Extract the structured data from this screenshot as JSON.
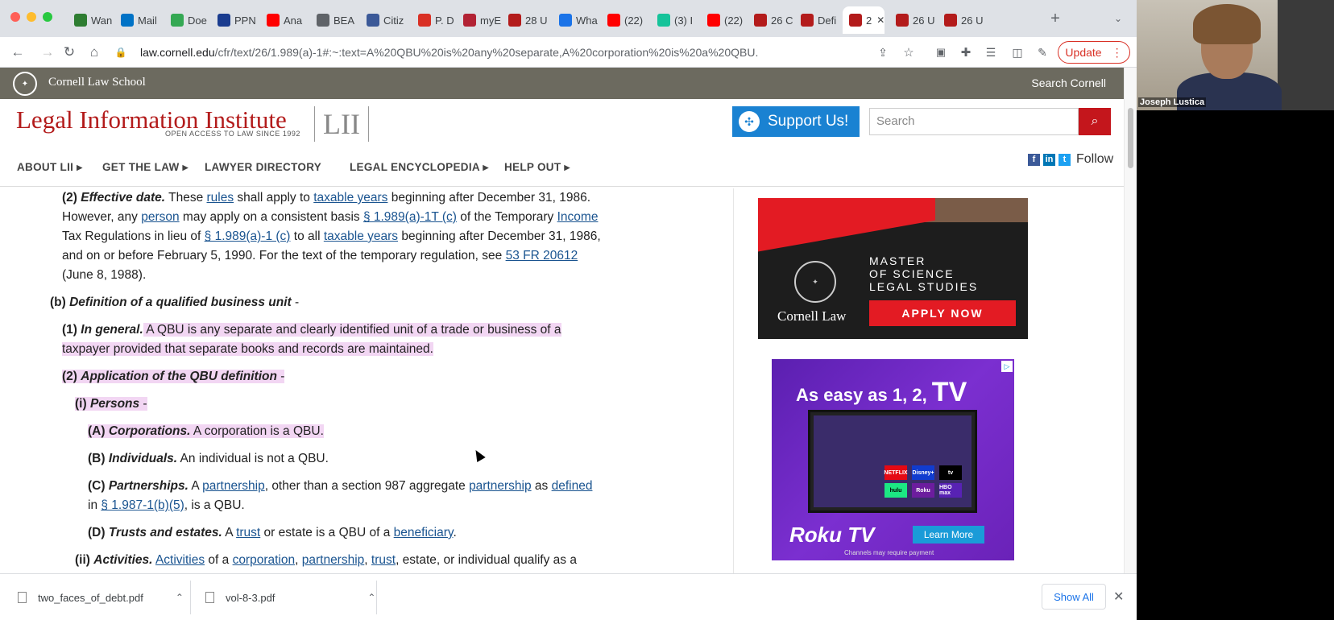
{
  "tabs": [
    {
      "label": "Wan",
      "icon": "green-square-icon",
      "color": "#2e7d32"
    },
    {
      "label": "Mail",
      "icon": "outlook-icon",
      "color": "#0072c6"
    },
    {
      "label": "Doe",
      "icon": "play-icon",
      "color": "#34a853"
    },
    {
      "label": "PPN",
      "icon": "flag-icon",
      "color": "#1a3c8f"
    },
    {
      "label": "Ana",
      "icon": "youtube-icon",
      "color": "#ff0000"
    },
    {
      "label": "BEA",
      "icon": "globe-icon",
      "color": "#5f6368"
    },
    {
      "label": "Citiz",
      "icon": "seal-icon",
      "color": "#3b5998"
    },
    {
      "label": "P. D",
      "icon": "gmail-icon",
      "color": "#d93025"
    },
    {
      "label": "myE",
      "icon": "flag-icon",
      "color": "#b22234"
    },
    {
      "label": "28 U",
      "icon": "lii-icon",
      "color": "#b31b1b"
    },
    {
      "label": "Wha",
      "icon": "document-icon",
      "color": "#1a73e8"
    },
    {
      "label": "(22)",
      "icon": "youtube-icon",
      "color": "#ff0000"
    },
    {
      "label": "(3) I",
      "icon": "grammarly-icon",
      "color": "#15c39a"
    },
    {
      "label": "(22)",
      "icon": "youtube-icon",
      "color": "#ff0000"
    },
    {
      "label": "26 C",
      "icon": "lii-icon",
      "color": "#b31b1b"
    },
    {
      "label": "Defi",
      "icon": "lii-icon",
      "color": "#b31b1b"
    },
    {
      "label": "2",
      "icon": "lii-icon",
      "color": "#b31b1b"
    },
    {
      "label": "26 U",
      "icon": "lii-icon",
      "color": "#b31b1b"
    },
    {
      "label": "26 U",
      "icon": "lii-icon",
      "color": "#b31b1b"
    }
  ],
  "address_bar": {
    "host": "law.cornell.edu",
    "path": "/cfr/text/26/1.989(a)-1#:~:text=A%20QBU%20is%20any%20separate,A%20corporation%20is%20a%20QBU."
  },
  "update_label": "Update",
  "cornell_bar": {
    "name": "Cornell Law School",
    "search": "Search Cornell"
  },
  "header": {
    "title": "Legal Information Institute",
    "tagline": "OPEN ACCESS TO LAW SINCE 1992",
    "box": "LII",
    "support": "Support Us!",
    "search_placeholder": "Search"
  },
  "nav": {
    "items": [
      "ABOUT LII",
      "GET THE LAW",
      "LAWYER DIRECTORY",
      "LEGAL ENCYCLOPEDIA",
      "HELP OUT"
    ],
    "follow": "Follow"
  },
  "content": {
    "p1": {
      "num": "(2)",
      "head": "Effective date.",
      "t1": " These ",
      "l_rules": "rules",
      "t2": " shall apply to ",
      "l_ty": "taxable years",
      "t3": " beginning after December 31, 1986."
    },
    "p1b": {
      "t1": "However, any ",
      "l_person": "person",
      "t2": " may apply on a consistent basis ",
      "l_sec": "§ 1.989(a)-1T (c)",
      "t3": " of the Temporary ",
      "l_income": "Income"
    },
    "p1c": {
      "t1": "Tax Regulations in lieu of ",
      "l_sec": "§ 1.989(a)-1 (c)",
      "t2": " to all ",
      "l_ty": "taxable years",
      "t3": " beginning after December 31, 1986,"
    },
    "p1d": {
      "t1": "and on or before February 5, 1990. For the text of the temporary regulation, see ",
      "l_fr": "53 FR 20612"
    },
    "p1e": {
      "t1": "(June 8, 1988)."
    },
    "b": {
      "num": "(b)",
      "head": "Definition of a qualified business unit",
      "t1": " -"
    },
    "b1": {
      "num": "(1)",
      "head": "In general.",
      "t1": " A QBU is any separate and clearly identified unit of a trade or business of a"
    },
    "b1b": {
      "t1": "taxpayer provided that separate books and records are maintained."
    },
    "b2": {
      "num": "(2)",
      "head": "Application of the QBU definition",
      "t1": " -"
    },
    "bi": {
      "num": "(i)",
      "head": "Persons",
      "t1": " -"
    },
    "bA": {
      "num": "(A)",
      "head": "Corporations.",
      "t1": " A corporation is a QBU."
    },
    "bB": {
      "num": "(B)",
      "head": "Individuals.",
      "t1": " An individual is not a QBU."
    },
    "bC": {
      "num": "(C)",
      "head": "Partnerships.",
      "t1": " A ",
      "l_p1": "partnership",
      "t2": ", other than a section 987 aggregate ",
      "l_p2": "partnership",
      "t3": " as ",
      "l_def": "defined"
    },
    "bC2": {
      "t1": "in ",
      "l_sec": "§ 1.987-1(b)(5)",
      "t2": ", is a QBU."
    },
    "bD": {
      "num": "(D)",
      "head": "Trusts and estates.",
      "t1": " A ",
      "l_trust": "trust",
      "t2": " or estate is a QBU of a ",
      "l_ben": "beneficiary",
      "t3": "."
    },
    "bii": {
      "num": "(ii)",
      "head": "Activities.",
      "t0": " ",
      "l_act": "Activities",
      "t1": " of a ",
      "l_corp": "corporation",
      "t2": ", ",
      "l_part": "partnership",
      "t3": ", ",
      "l_trust": "trust",
      "t4": ", estate, or individual qualify as a"
    }
  },
  "ads": {
    "ad1": {
      "line1": "MASTER",
      "line2": "OF SCIENCE",
      "line3": "LEGAL STUDIES",
      "brand": "Cornell Law",
      "cta": "APPLY NOW"
    },
    "ad2": {
      "headline": "As easy as 1, 2, ",
      "headline_big": "TV",
      "brand": "Roku TV",
      "cta": "Learn More",
      "note": "Channels may require payment",
      "apps": [
        "NETFLIX",
        "Disney+",
        "tv",
        "hulu",
        "Roku",
        "HBO max"
      ]
    }
  },
  "downloads": {
    "items": [
      "two_faces_of_debt.pdf",
      "vol-8-3.pdf"
    ],
    "show_all": "Show All"
  },
  "video": {
    "participant": "Joseph Lustica"
  }
}
